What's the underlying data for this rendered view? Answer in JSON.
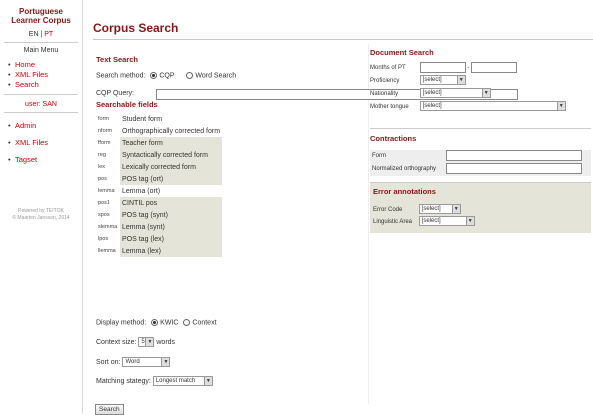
{
  "sidebar": {
    "logo_line1": "Portuguese",
    "logo_line2": "Learner Corpus",
    "lang_en": "EN",
    "lang_sep": " | ",
    "lang_pt": "PT",
    "menu_title": "Main Menu",
    "menu": [
      {
        "label": "Home"
      },
      {
        "label": "XML Files"
      },
      {
        "label": "Search"
      }
    ],
    "user": "user: SAN",
    "admin_menu": [
      {
        "label": "Admin"
      },
      {
        "label": "XML Files"
      },
      {
        "label": "Tagset"
      }
    ],
    "footer1": "Powered by TEITOK",
    "footer2": "© Maarten Janssen, 2014"
  },
  "page": {
    "title": "Corpus Search"
  },
  "text_search": {
    "heading": "Text Search",
    "method_label": "Search method:",
    "method_cqp": "CQP",
    "method_word": "Word Search",
    "query_label": "CQP Query:",
    "query_value": ""
  },
  "fields": {
    "heading": "Searchable fields",
    "rows": [
      {
        "code": "form",
        "label": "Student form"
      },
      {
        "code": "nform",
        "label": "Orthographically corrected form"
      },
      {
        "code": "fform",
        "label": "Teacher form"
      },
      {
        "code": "reg",
        "label": "Syntactically corrected form"
      },
      {
        "code": "lex",
        "label": "Lexically corrected form"
      },
      {
        "code": "pos",
        "label": "POS tag (ort)"
      },
      {
        "code": "lemma",
        "label": "Lemma (ort)"
      },
      {
        "code": "pos1",
        "label": "CINTIL pos"
      },
      {
        "code": "spos",
        "label": "POS tag (synt)"
      },
      {
        "code": "slemma",
        "label": "Lemma (synt)"
      },
      {
        "code": "lpos",
        "label": "POS tag (lex)"
      },
      {
        "code": "llemma",
        "label": "Lemma (lex)"
      }
    ]
  },
  "display": {
    "method_label": "Display method:",
    "kwic": "KWIC",
    "context": "Context",
    "context_size_label": "Context size:",
    "context_size_value": "5",
    "context_size_unit": "words",
    "sort_label": "Sort on:",
    "sort_value": "Word",
    "matching_label": "Matching stategy:",
    "matching_value": "Longest match",
    "search_button": "Search"
  },
  "document_search": {
    "heading": "Document Search",
    "months_label": "Months of PT",
    "months_sep": "-",
    "proficiency_label": "Proficiency",
    "proficiency_value": "[select]",
    "nationality_label": "Nationality",
    "nationality_value": "[select]",
    "mother_tongue_label": "Mother tongue",
    "mother_tongue_value": "[select]"
  },
  "contractions": {
    "heading": "Contractions",
    "form_label": "Form",
    "norm_label": "Normalized orthography"
  },
  "error_annotations": {
    "heading": "Error annotations",
    "code_label": "Error Code",
    "code_value": "[select]",
    "area_label": "Linguistic Area",
    "area_value": "[select]"
  }
}
